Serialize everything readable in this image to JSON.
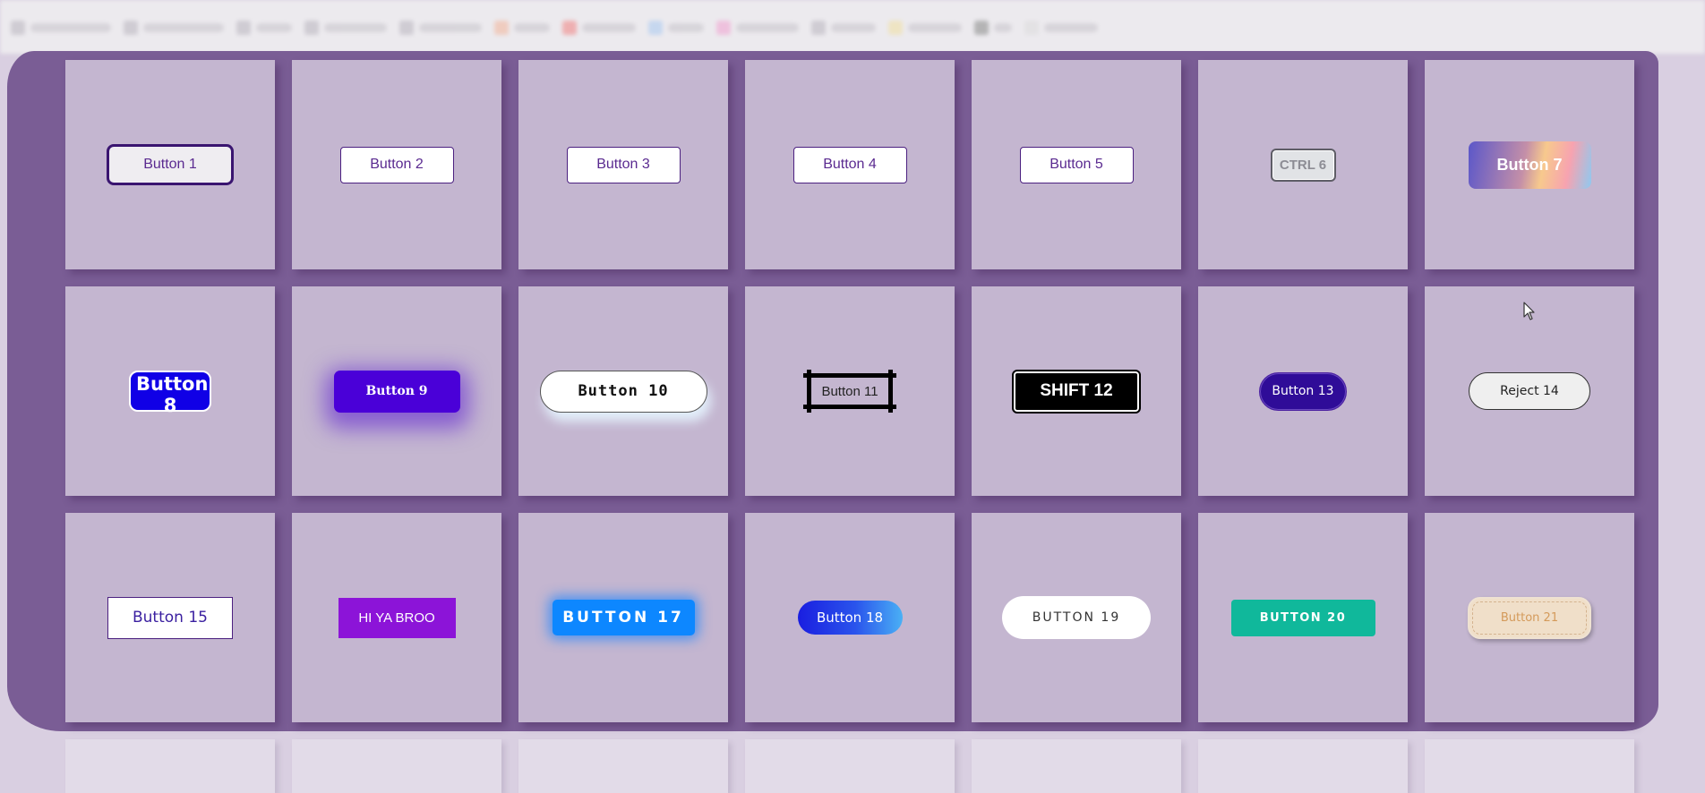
{
  "buttons": [
    {
      "label": "Button 1"
    },
    {
      "label": "Button 2"
    },
    {
      "label": "Button 3"
    },
    {
      "label": "Button 4"
    },
    {
      "label": "Button 5"
    },
    {
      "label": "CTRL 6"
    },
    {
      "label": "Button 7"
    },
    {
      "label": "Button 8"
    },
    {
      "label": "Button 9"
    },
    {
      "label": "Button 10"
    },
    {
      "label": "Button 11"
    },
    {
      "label": "SHIFT 12"
    },
    {
      "label": "Button 13"
    },
    {
      "label": "Reject 14"
    },
    {
      "label": "Button 15"
    },
    {
      "label": "HI YA BROO"
    },
    {
      "label": "BUTTON 17"
    },
    {
      "label": "Button 18"
    },
    {
      "label": "BUTTON 19"
    },
    {
      "label": "BUTTON 20"
    },
    {
      "label": "Button 21"
    }
  ],
  "colors": {
    "page_background": "#d9cfe1",
    "panel_background": "#7a5d95",
    "cell_background": "#c4b6d0"
  },
  "icons": {
    "cursor": "mouse-pointer-icon"
  }
}
